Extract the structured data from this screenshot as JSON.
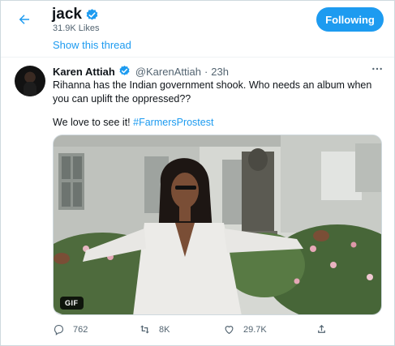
{
  "header": {
    "title": "jack",
    "likes": "31.9K Likes",
    "follow_label": "Following",
    "show_thread": "Show this thread"
  },
  "tweet": {
    "author_name": "Karen Attiah",
    "handle": "@KarenAttiah",
    "separator": "·",
    "time": "23h",
    "text_line1": "Rihanna has the Indian government shook. Who needs an album when you can uplift the oppressed??",
    "text_line2_prefix": "We love to see it! ",
    "hashtag": "#FarmersProstest",
    "media_badge": "GIF"
  },
  "actions": {
    "reply_count": "762",
    "retweet_count": "8K",
    "like_count": "29.7K"
  },
  "colors": {
    "accent": "#1d9bf0",
    "muted": "#536471",
    "text": "#0f1419"
  },
  "icons": [
    "back-arrow-icon",
    "verified-badge-icon",
    "more-icon",
    "reply-icon",
    "retweet-icon",
    "like-icon",
    "share-icon"
  ]
}
